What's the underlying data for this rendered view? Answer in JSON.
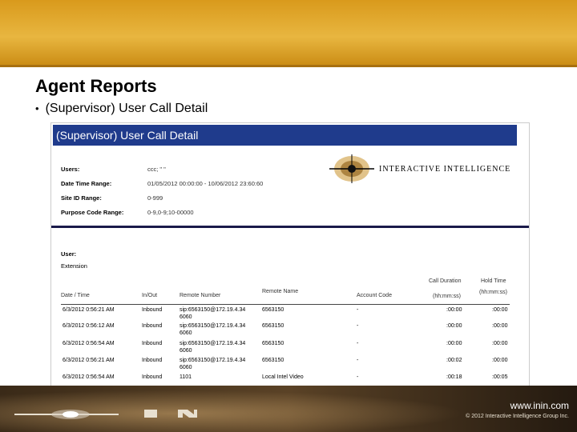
{
  "slide": {
    "title": "Agent Reports",
    "bullet": "(Supervisor) User Call Detail"
  },
  "report": {
    "header": "(Supervisor) User Call Detail",
    "params": [
      {
        "label": "Users:",
        "value": "ccc; \" \""
      },
      {
        "label": "Date Time Range:",
        "value": "01/05/2012 00:00:00 - 10/06/2012 23:60:60"
      },
      {
        "label": "Site ID Range:",
        "value": "0-999"
      },
      {
        "label": "Purpose Code Range:",
        "value": "0-9,0-9;10-00000"
      }
    ],
    "logo_text": "INTERACTIVE INTELLIGENCE",
    "user_label": "User:",
    "extension_label": "Extension",
    "columns": {
      "date_time": "Date / Time",
      "in_out": "In/Out",
      "remote_number": "Remote Number",
      "remote_name": "Remote Name",
      "account_code": "Account Code",
      "call_duration": "Call Duration",
      "call_duration_unit": "(hh:mm:ss)",
      "hold_time": "Hold Time",
      "hold_time_unit": "(hh:mm:ss)"
    },
    "rows": [
      {
        "date": "6/3/2012 0:56:21 AM",
        "dir": "Inbound",
        "num": "sip:6563150@172.19.4.34",
        "num2": "6060",
        "name": "6563150",
        "acct": "-",
        "dur": ":00:00",
        "hold": ":00:00"
      },
      {
        "date": "6/3/2012 0:56:12 AM",
        "dir": "Inbound",
        "num": "sip:6563150@172.19.4.34",
        "num2": "6060",
        "name": "6563150",
        "acct": "-",
        "dur": ":00:00",
        "hold": ":00:00"
      },
      {
        "date": "6/3/2012 0:56:54 AM",
        "dir": "Inbound",
        "num": "sip:6563150@172.19.4.34",
        "num2": "6060",
        "name": "6563150",
        "acct": "-",
        "dur": ":00:00",
        "hold": ":00:00"
      },
      {
        "date": "6/3/2012 0:56:21 AM",
        "dir": "Inbound",
        "num": "sip:6563150@172.19.4.34",
        "num2": "6060",
        "name": "6563150",
        "acct": "-",
        "dur": ":00:02",
        "hold": ":00:00"
      },
      {
        "date": "6/3/2012 0:56:54 AM",
        "dir": "Inbound",
        "num": "1101",
        "num2": "",
        "name": "Local Intel Video",
        "acct": "-",
        "dur": ":00:18",
        "hold": ":00:05"
      }
    ]
  },
  "footer": {
    "url": "www.inin.com",
    "copyright": "© 2012 Interactive Intelligence Group Inc.",
    "logo_letters": "I N"
  }
}
